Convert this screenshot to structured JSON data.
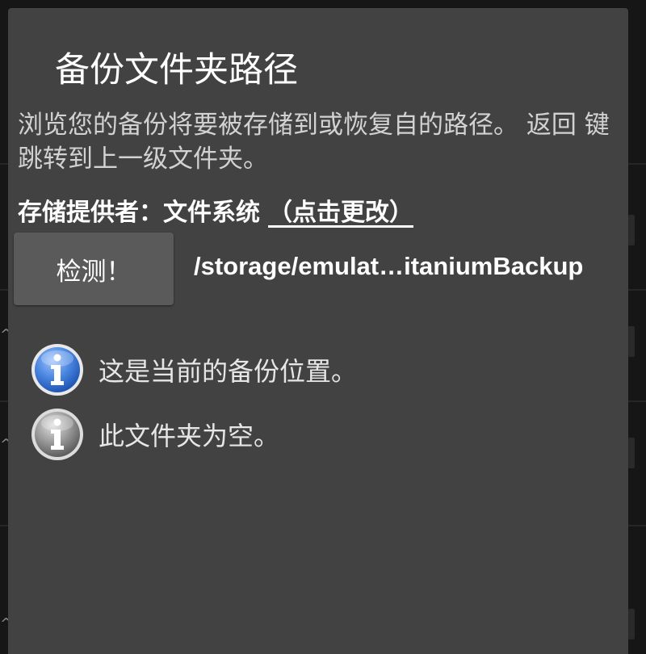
{
  "dialog": {
    "title": "备份文件夹路径",
    "description": "浏览您的备份将要被存储到或恢复自的路径。 返回 键跳转到上一级文件夹。",
    "provider_label": "存储提供者：文件系统",
    "provider_change_link": "（点击更改）",
    "detect_button_label": "检测！",
    "path": "/storage/emulat…itaniumBackup",
    "info_items": [
      {
        "text": "这是当前的备份位置。",
        "icon": "info-icon-blue"
      },
      {
        "text": "此文件夹为空。",
        "icon": "info-icon-gray"
      }
    ]
  },
  "colors": {
    "dialog_background": "#424242",
    "button_background": "#5a5a5a",
    "info_blue": "#3f79d2",
    "info_gray": "#8c8c8c"
  }
}
